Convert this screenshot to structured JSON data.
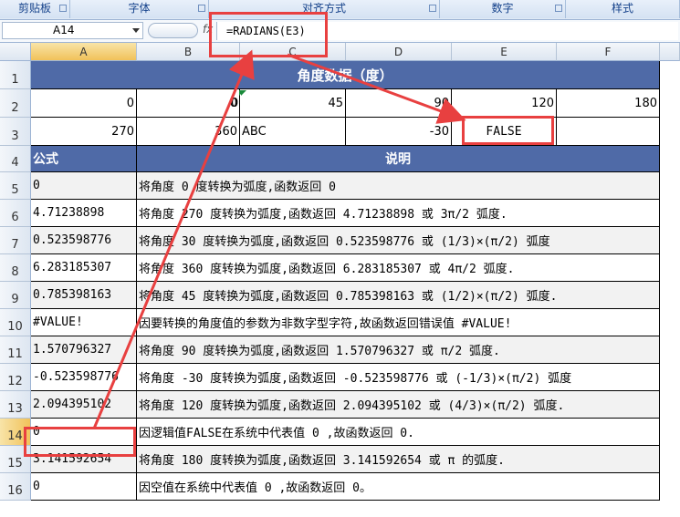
{
  "ribbon": {
    "groups": [
      {
        "label": "剪贴板"
      },
      {
        "label": "字体"
      },
      {
        "label": "对齐方式"
      },
      {
        "label": "数字"
      },
      {
        "label": "样式"
      }
    ]
  },
  "formula_bar": {
    "name_box": "A14",
    "fx_label": "fx",
    "formula": "=RADIANS(E3)"
  },
  "columns": [
    "A",
    "B",
    "C",
    "D",
    "E",
    "F"
  ],
  "rows": [
    "1",
    "2",
    "3",
    "4",
    "5",
    "6",
    "7",
    "8",
    "9",
    "10",
    "11",
    "12",
    "13",
    "14",
    "15",
    "16"
  ],
  "title": "角度数据（度）",
  "data_row2": [
    "0",
    "0",
    "0",
    "45",
    "90",
    "120",
    "180"
  ],
  "data_row3": [
    "270",
    "360",
    "ABC",
    "-30",
    "FALSE"
  ],
  "header": {
    "formula": "公式",
    "description": "说明"
  },
  "results": [
    {
      "value": "0",
      "desc": "将角度 0 度转换为弧度,函数返回 0"
    },
    {
      "value": "4.71238898",
      "desc": "将角度 270 度转换为弧度,函数返回 4.71238898  或 3π/2 弧度."
    },
    {
      "value": "0.523598776",
      "desc": "将角度 30 度转换为弧度,函数返回 0.523598776  或 (1/3)×(π/2) 弧度"
    },
    {
      "value": "6.283185307",
      "desc": "将角度 360 度转换为弧度,函数返回 6.283185307  或 4π/2 弧度."
    },
    {
      "value": "0.785398163",
      "desc": "将角度 45 度转换为弧度,函数返回 0.785398163  或 (1/2)×(π/2) 弧度."
    },
    {
      "value": "#VALUE!",
      "desc": "因要转换的角度值的参数为非数字型字符,故函数返回错误值 #VALUE!"
    },
    {
      "value": "1.570796327",
      "desc": "将角度 90 度转换为弧度,函数返回 1.570796327  或 π/2 弧度."
    },
    {
      "value": "-0.523598776",
      "desc": "将角度 -30 度转换为弧度,函数返回 -0.523598776  或 (-1/3)×(π/2) 弧度"
    },
    {
      "value": "2.094395102",
      "desc": "将角度 120 度转换为弧度,函数返回 2.094395102  或 (4/3)×(π/2) 弧度."
    },
    {
      "value": "0",
      "desc": "因逻辑值FALSE在系统中代表值 0 ,故函数返回 0."
    },
    {
      "value": "3.141592654",
      "desc": "将角度 180 度转换为弧度,函数返回 3.141592654 或 π 的弧度."
    },
    {
      "value": "0",
      "desc": "因空值在系统中代表值 0 ,故函数返回 0。"
    }
  ],
  "colors": {
    "header_bg": "#4f6aa7",
    "highlight": "#e84040",
    "alt_row": "#f2f2f2"
  }
}
